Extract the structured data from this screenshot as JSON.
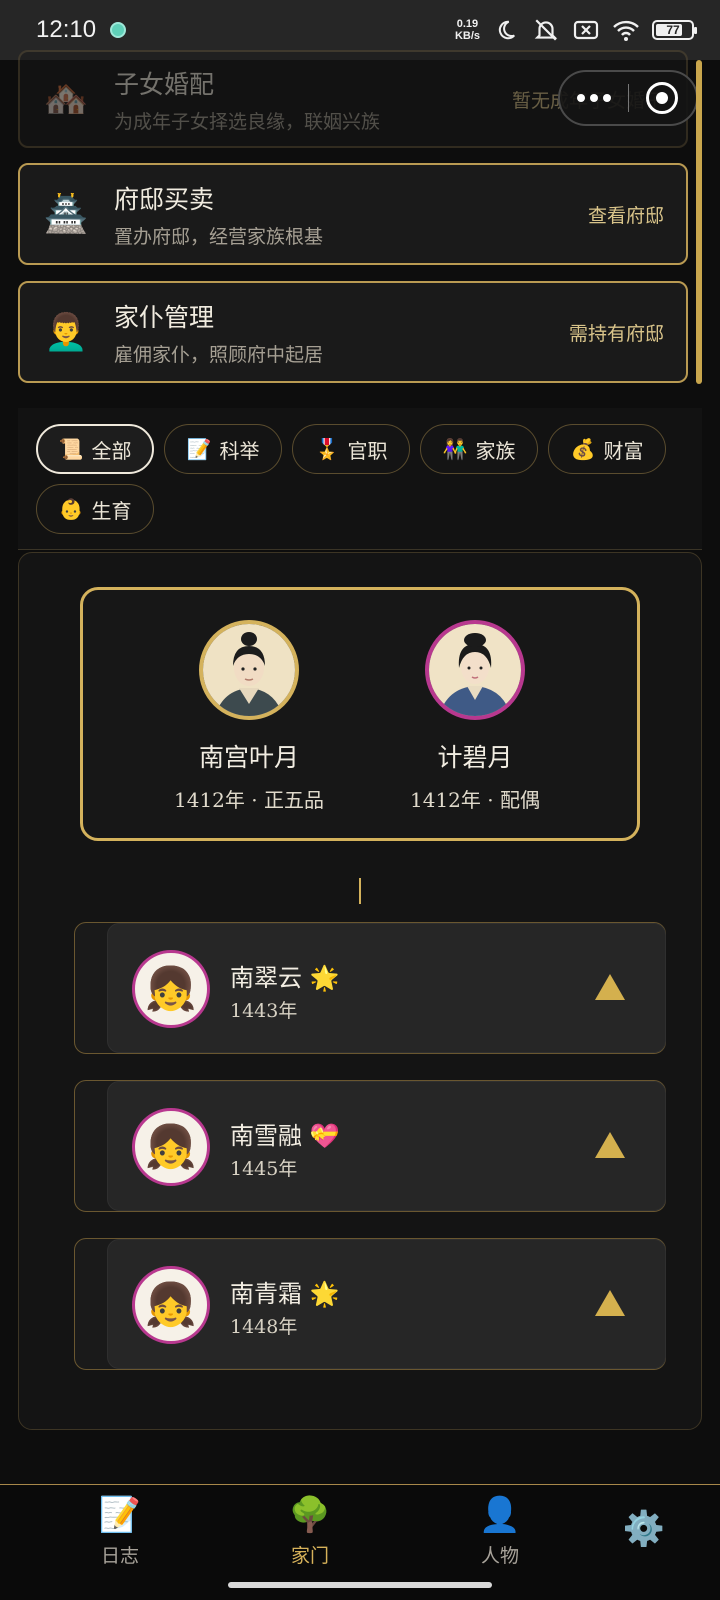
{
  "status_bar": {
    "time": "12:10",
    "speed_value": "0.19",
    "speed_unit": "KB/s",
    "battery": "77",
    "icons": [
      "app-icon",
      "moon-icon",
      "mute-bell-icon",
      "no-sim-icon",
      "wifi-icon",
      "battery-icon"
    ]
  },
  "features": [
    {
      "icon": "🏘️",
      "title": "子女婚配",
      "subtitle": "为成年子女择选良缘，联姻兴族",
      "action": "暂无成年子女婚子"
    },
    {
      "icon": "🏯",
      "title": "府邸买卖",
      "subtitle": "置办府邸，经营家族根基",
      "action": "查看府邸"
    },
    {
      "icon": "👨‍🦱",
      "title": "家仆管理",
      "subtitle": "雇佣家仆，照顾府中起居",
      "action": "需持有府邸"
    }
  ],
  "filters": [
    {
      "icon": "📜",
      "label": "全部",
      "active": true
    },
    {
      "icon": "📝",
      "label": "科举"
    },
    {
      "icon": "🎖️",
      "label": "官职"
    },
    {
      "icon": "👫",
      "label": "家族"
    },
    {
      "icon": "💰",
      "label": "财富"
    },
    {
      "icon": "👶",
      "label": "生育"
    }
  ],
  "couple": {
    "husband": {
      "name": "南宫叶月",
      "info": "1412年 · 正五品",
      "ring_color": "#d4b25c"
    },
    "wife": {
      "name": "计碧月",
      "info": "1412年 · 配偶",
      "ring_color": "#b8388f"
    }
  },
  "children": [
    {
      "name": "南翠云",
      "badge": "🌟",
      "year": "1443年",
      "avatar": "👧"
    },
    {
      "name": "南雪融",
      "badge": "💝",
      "year": "1445年",
      "avatar": "👧"
    },
    {
      "name": "南青霜",
      "badge": "🌟",
      "year": "1448年",
      "avatar": "👧"
    }
  ],
  "nav": [
    {
      "icon": "📝",
      "label": "日志"
    },
    {
      "icon": "🌳",
      "label": "家门",
      "active": true
    },
    {
      "icon": "👤",
      "label": "人物"
    },
    {
      "icon": "⚙️",
      "label": ""
    }
  ],
  "colors": {
    "accent": "#d4b25c",
    "female_ring": "#b8388f",
    "background": "#0d0d0d"
  }
}
